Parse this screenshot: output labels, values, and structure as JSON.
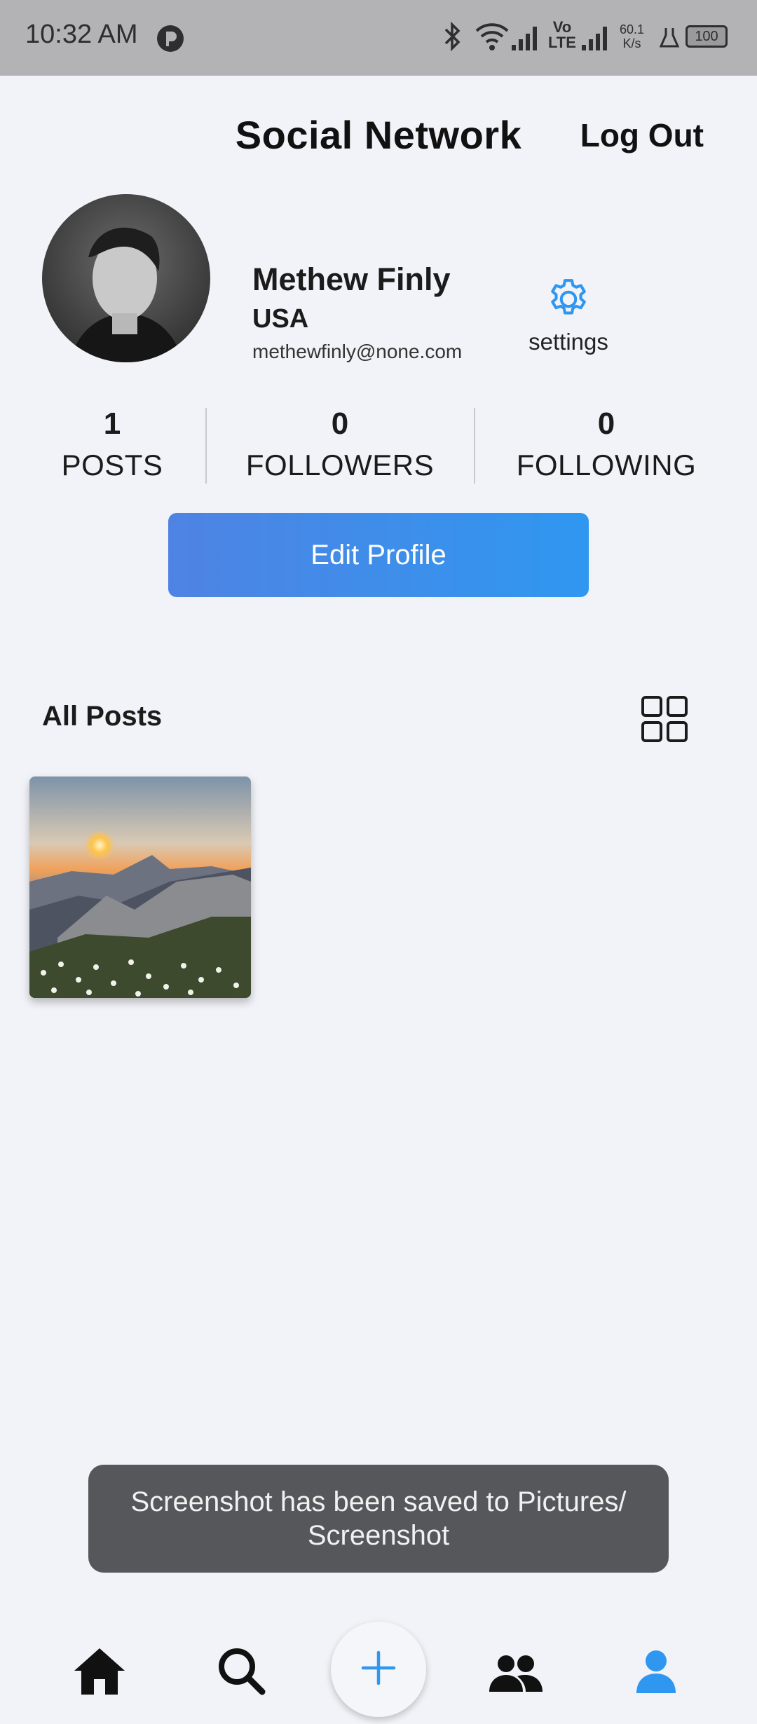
{
  "status_bar": {
    "time": "10:32 AM",
    "net_speed_value": "60.1",
    "net_speed_unit": "K/s",
    "volte": "Vo",
    "lte": "LTE",
    "battery": "100"
  },
  "header": {
    "title": "Social Network",
    "logout_label": "Log Out"
  },
  "profile": {
    "name": "Methew Finly",
    "country": "USA",
    "email": "methewfinly@none.com",
    "settings_label": "settings"
  },
  "stats": [
    {
      "value": "1",
      "label": "POSTS"
    },
    {
      "value": "0",
      "label": "FOLLOWERS"
    },
    {
      "value": "0",
      "label": "FOLLOWING"
    }
  ],
  "edit_profile_label": "Edit Profile",
  "posts_section": {
    "title": "All Posts",
    "post_count_shown": 1
  },
  "toast": {
    "message": "Screenshot has been saved to  Pictures/ Screenshot"
  },
  "bottom_nav": {
    "items": [
      "home-icon",
      "search-icon",
      "add-icon",
      "people-icon",
      "profile-icon"
    ],
    "active": "profile-icon"
  },
  "colors": {
    "accent": "#2f97f0",
    "button_gradient_start": "#4f83e3",
    "background": "#f2f3f8",
    "toast": "#56575b"
  }
}
